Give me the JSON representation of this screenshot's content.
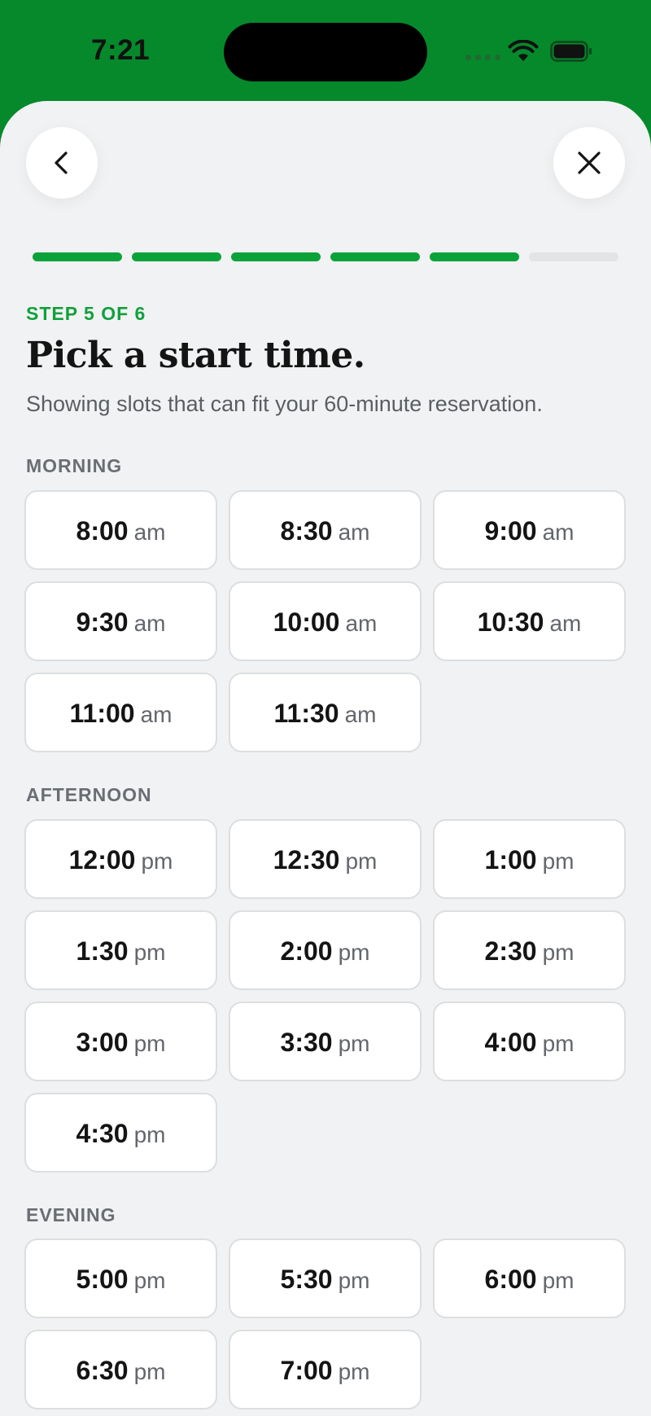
{
  "status": {
    "time": "7:21"
  },
  "header": {
    "step": "STEP 5 OF 6",
    "title": "Pick a start time.",
    "subtitle": "Showing slots that can fit your 60-minute reservation."
  },
  "progress": {
    "total_steps": 6,
    "completed_steps": 5
  },
  "colors": {
    "brand": "#05892b",
    "accent": "#0ba23a",
    "background": "#f1f2f3"
  },
  "icons": {
    "back": "chevron-left-icon",
    "close": "close-icon"
  },
  "sections": [
    {
      "label": "MORNING",
      "slots": [
        {
          "time": "8:00",
          "period": "am"
        },
        {
          "time": "8:30",
          "period": "am"
        },
        {
          "time": "9:00",
          "period": "am"
        },
        {
          "time": "9:30",
          "period": "am"
        },
        {
          "time": "10:00",
          "period": "am"
        },
        {
          "time": "10:30",
          "period": "am"
        },
        {
          "time": "11:00",
          "period": "am"
        },
        {
          "time": "11:30",
          "period": "am"
        }
      ]
    },
    {
      "label": "AFTERNOON",
      "slots": [
        {
          "time": "12:00",
          "period": "pm"
        },
        {
          "time": "12:30",
          "period": "pm"
        },
        {
          "time": "1:00",
          "period": "pm"
        },
        {
          "time": "1:30",
          "period": "pm"
        },
        {
          "time": "2:00",
          "period": "pm"
        },
        {
          "time": "2:30",
          "period": "pm"
        },
        {
          "time": "3:00",
          "period": "pm"
        },
        {
          "time": "3:30",
          "period": "pm"
        },
        {
          "time": "4:00",
          "period": "pm"
        },
        {
          "time": "4:30",
          "period": "pm"
        }
      ]
    },
    {
      "label": "EVENING",
      "slots": [
        {
          "time": "5:00",
          "period": "pm"
        },
        {
          "time": "5:30",
          "period": "pm"
        },
        {
          "time": "6:00",
          "period": "pm"
        },
        {
          "time": "6:30",
          "period": "pm"
        },
        {
          "time": "7:00",
          "period": "pm"
        }
      ]
    }
  ]
}
